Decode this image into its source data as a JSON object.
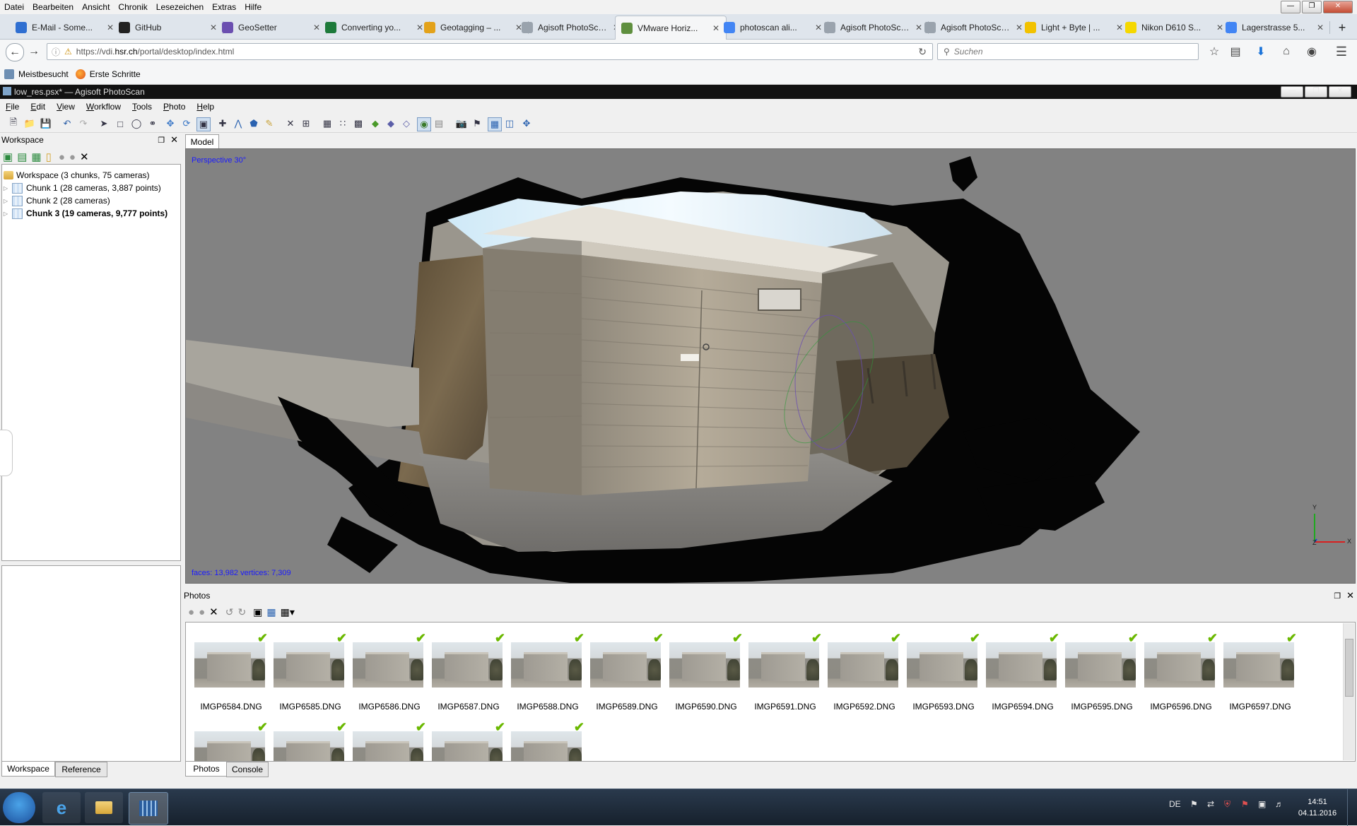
{
  "firefox": {
    "menu": [
      "Datei",
      "Bearbeiten",
      "Ansicht",
      "Chronik",
      "Lesezeichen",
      "Extras",
      "Hilfe"
    ],
    "tabs": [
      {
        "title": "E-Mail - Some...",
        "icon": "mail-icon",
        "color": "#2f6fd1"
      },
      {
        "title": "GitHub",
        "icon": "github-icon",
        "color": "#222222"
      },
      {
        "title": "GeoSetter",
        "icon": "geosetter-icon",
        "color": "#6b4fb0"
      },
      {
        "title": "Converting yo...",
        "icon": "excel-icon",
        "color": "#1d7a3a"
      },
      {
        "title": "Geotagging – ...",
        "icon": "geotag-icon",
        "color": "#e3a21a"
      },
      {
        "title": "Agisoft PhotoSca...",
        "icon": "agisoft-icon",
        "color": "#9aa3ad"
      },
      {
        "title": "VMware Horiz...",
        "icon": "vmware-icon",
        "color": "#5f8f3e"
      },
      {
        "title": "photoscan ali...",
        "icon": "google-icon",
        "color": "#4285f4"
      },
      {
        "title": "Agisoft PhotoSca...",
        "icon": "agisoft-icon",
        "color": "#9aa3ad"
      },
      {
        "title": "Agisoft PhotoSca...",
        "icon": "agisoft-icon",
        "color": "#9aa3ad"
      },
      {
        "title": "Light + Byte | ...",
        "icon": "lightbyte-icon",
        "color": "#f2c200"
      },
      {
        "title": "Nikon D610 S...",
        "icon": "nikon-icon",
        "color": "#f5d800"
      },
      {
        "title": "Lagerstrasse 5...",
        "icon": "google-icon",
        "color": "#4285f4"
      }
    ],
    "new_tab_label": "+",
    "url_prefix": "https://vdi.",
    "url_host": "hsr.ch",
    "url_path": "/portal/desktop/index.html",
    "search_placeholder": "Suchen",
    "bookmarks": [
      "Meistbesucht",
      "Erste Schritte"
    ]
  },
  "photoscan": {
    "window_title": "low_res.psx* — Agisoft PhotoScan",
    "menu": [
      "File",
      "Edit",
      "View",
      "Workflow",
      "Tools",
      "Photo",
      "Help"
    ],
    "workspace": {
      "header": "Workspace",
      "root": "Workspace (3 chunks, 75 cameras)",
      "chunks": [
        {
          "label": "Chunk 1 (28 cameras, 3,887 points)",
          "bold": false
        },
        {
          "label": "Chunk 2 (28 cameras)",
          "bold": false
        },
        {
          "label": "Chunk 3 (19 cameras, 9,777 points)",
          "bold": true
        }
      ],
      "bottom_tabs": [
        "Workspace",
        "Reference"
      ]
    },
    "model": {
      "tab": "Model",
      "projection": "Perspective 30°",
      "stats": "faces: 13,982 vertices: 7,309",
      "axis_y": "Y",
      "axis_x": "X",
      "axis_z": "Z"
    },
    "photos": {
      "header": "Photos",
      "bottom_tabs": [
        "Photos",
        "Console"
      ],
      "row1": [
        "IMGP6584.DNG",
        "IMGP6585.DNG",
        "IMGP6586.DNG",
        "IMGP6587.DNG",
        "IMGP6588.DNG",
        "IMGP6589.DNG",
        "IMGP6590.DNG",
        "IMGP6591.DNG",
        "IMGP6592.DNG",
        "IMGP6593.DNG",
        "IMGP6594.DNG",
        "IMGP6595.DNG",
        "IMGP6596.DNG",
        "IMGP6597.DNG"
      ],
      "row2_count": 5
    }
  },
  "taskbar": {
    "lang": "DE",
    "time": "14:51",
    "date": "04.11.2016"
  }
}
